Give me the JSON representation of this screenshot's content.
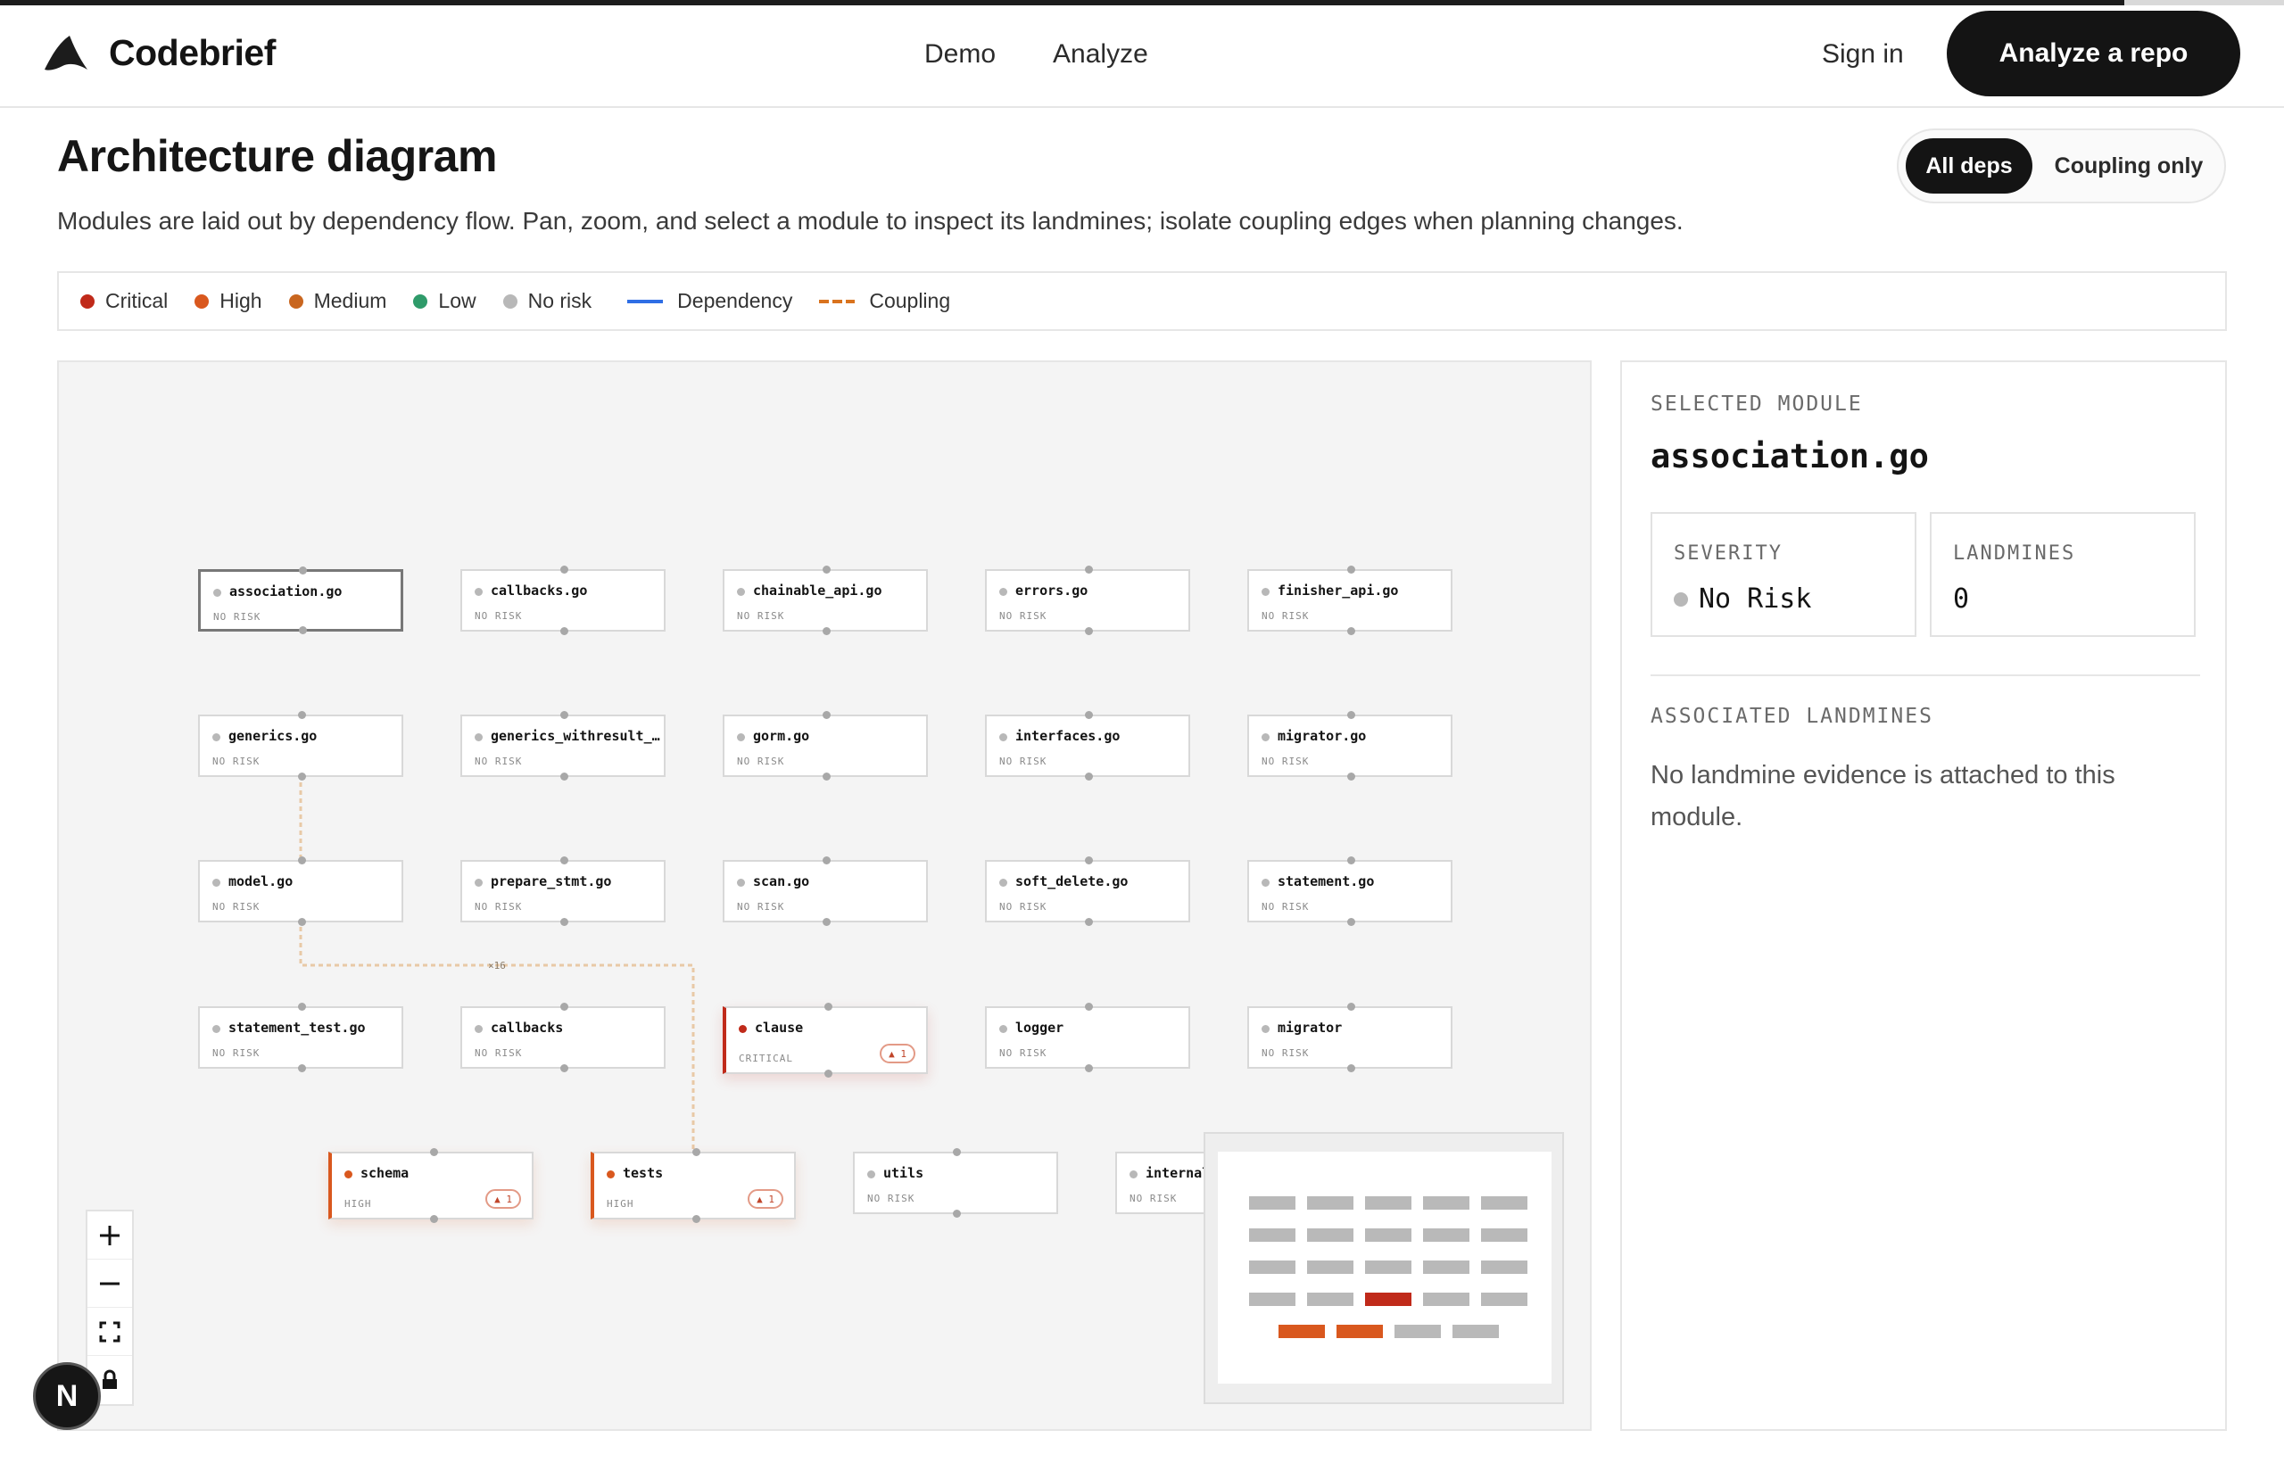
{
  "progress": 0.93,
  "header": {
    "brand": "Codebrief",
    "nav": [
      "Demo",
      "Analyze"
    ],
    "sign_in": "Sign in",
    "cta": "Analyze a repo"
  },
  "page": {
    "title": "Architecture diagram",
    "subtitle": "Modules are laid out by dependency flow. Pan, zoom, and select a module to inspect its landmines; isolate coupling edges when planning changes.",
    "toggle": {
      "options": [
        "All deps",
        "Coupling only"
      ],
      "selected": "All deps"
    }
  },
  "legend": {
    "risk_levels": [
      {
        "label": "Critical",
        "color": "#c02a1a"
      },
      {
        "label": "High",
        "color": "#d9581e"
      },
      {
        "label": "Medium",
        "color": "#c9661f"
      },
      {
        "label": "Low",
        "color": "#2f9b6a"
      },
      {
        "label": "No risk",
        "color": "#b8b8b8"
      }
    ],
    "edges": [
      {
        "label": "Dependency",
        "color": "#2f6ee5"
      },
      {
        "label": "Coupling",
        "color": "#d9731e"
      }
    ]
  },
  "diagram": {
    "edge_label": "×16",
    "nodes": [
      {
        "name": "association.go",
        "risk": "NO RISK",
        "level": "none",
        "selected": true
      },
      {
        "name": "callbacks.go",
        "risk": "NO RISK",
        "level": "none"
      },
      {
        "name": "chainable_api.go",
        "risk": "NO RISK",
        "level": "none"
      },
      {
        "name": "errors.go",
        "risk": "NO RISK",
        "level": "none"
      },
      {
        "name": "finisher_api.go",
        "risk": "NO RISK",
        "level": "none"
      },
      {
        "name": "generics.go",
        "risk": "NO RISK",
        "level": "none"
      },
      {
        "name": "generics_withresult_…",
        "risk": "NO RISK",
        "level": "none"
      },
      {
        "name": "gorm.go",
        "risk": "NO RISK",
        "level": "none"
      },
      {
        "name": "interfaces.go",
        "risk": "NO RISK",
        "level": "none"
      },
      {
        "name": "migrator.go",
        "risk": "NO RISK",
        "level": "none"
      },
      {
        "name": "model.go",
        "risk": "NO RISK",
        "level": "none"
      },
      {
        "name": "prepare_stmt.go",
        "risk": "NO RISK",
        "level": "none"
      },
      {
        "name": "scan.go",
        "risk": "NO RISK",
        "level": "none"
      },
      {
        "name": "soft_delete.go",
        "risk": "NO RISK",
        "level": "none"
      },
      {
        "name": "statement.go",
        "risk": "NO RISK",
        "level": "none"
      },
      {
        "name": "statement_test.go",
        "risk": "NO RISK",
        "level": "none"
      },
      {
        "name": "callbacks",
        "risk": "NO RISK",
        "level": "none"
      },
      {
        "name": "clause",
        "risk": "CRITICAL",
        "level": "critical",
        "badge": "▲ 1"
      },
      {
        "name": "logger",
        "risk": "NO RISK",
        "level": "none"
      },
      {
        "name": "migrator",
        "risk": "NO RISK",
        "level": "none"
      },
      {
        "name": "schema",
        "risk": "HIGH",
        "level": "high",
        "badge": "▲ 1"
      },
      {
        "name": "tests",
        "risk": "HIGH",
        "level": "high",
        "badge": "▲ 1"
      },
      {
        "name": "utils",
        "risk": "NO RISK",
        "level": "none"
      },
      {
        "name": "internal",
        "risk": "NO RISK",
        "level": "none"
      }
    ],
    "controls": [
      "zoom-in",
      "zoom-out",
      "fit-view",
      "lock"
    ]
  },
  "panel": {
    "selected_label": "SELECTED MODULE",
    "module": "association.go",
    "severity_label": "SEVERITY",
    "severity_value": "No Risk",
    "landmines_label": "LANDMINES",
    "landmines_value": "0",
    "associated_label": "ASSOCIATED LANDMINES",
    "empty_text": "No landmine evidence is attached to this module."
  },
  "badge": {
    "letter": "N"
  }
}
